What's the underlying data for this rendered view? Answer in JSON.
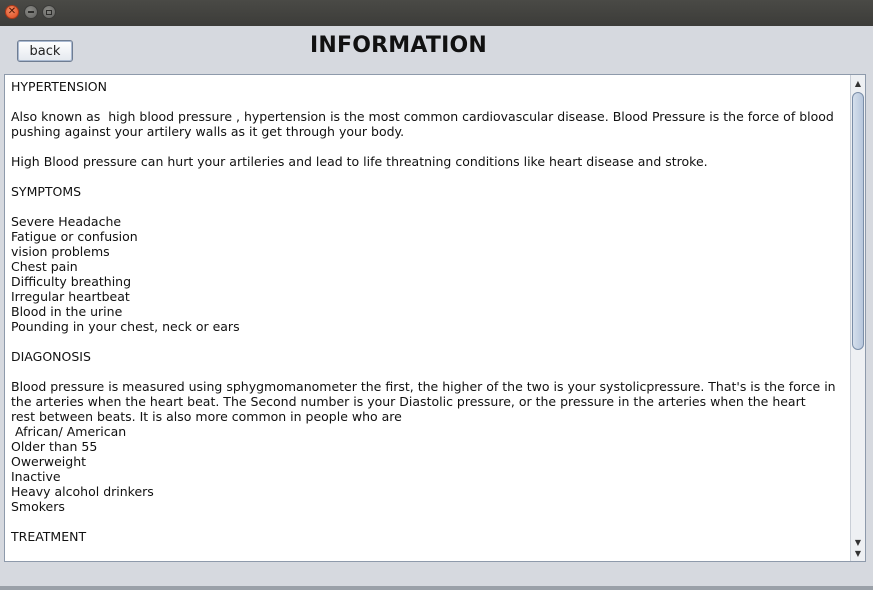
{
  "window": {
    "controls": {
      "close_icon": "close-icon",
      "minimize_icon": "minimize-icon",
      "maximize_icon": "maximize-icon"
    }
  },
  "header": {
    "back_label": "back",
    "title": "INFORMATION"
  },
  "content": {
    "lines": [
      "HYPERTENSION",
      "",
      "Also known as  high blood pressure , hypertension is the most common cardiovascular disease. Blood Pressure is the force of blood",
      "pushing against your artilery walls as it get through your body.",
      "",
      "High Blood pressure can hurt your artileries and lead to life threatning conditions like heart disease and stroke.",
      "",
      "SYMPTOMS",
      "",
      "Severe Headache",
      "Fatigue or confusion",
      "vision problems",
      "Chest pain",
      "Difficulty breathing",
      "Irregular heartbeat",
      "Blood in the urine",
      "Pounding in your chest, neck or ears",
      "",
      "DIAGONOSIS",
      "",
      "Blood pressure is measured using sphygmomanometer the first, the higher of the two is your systolicpressure. That's is the force in",
      "the arteries when the heart beat. The Second number is your Diastolic pressure, or the pressure in the arteries when the heart",
      "rest between beats. It is also more common in people who are",
      " African/ American",
      "Older than 55",
      "Owerweight",
      "Inactive",
      "Heavy alcohol drinkers",
      "Smokers",
      "",
      "TREATMENT"
    ]
  },
  "scrollbar": {
    "up_icon": "scroll-up-arrow-icon",
    "down_icon": "scroll-down-arrow-icon",
    "position_fraction": 0.0,
    "visible_fraction": 0.55
  }
}
